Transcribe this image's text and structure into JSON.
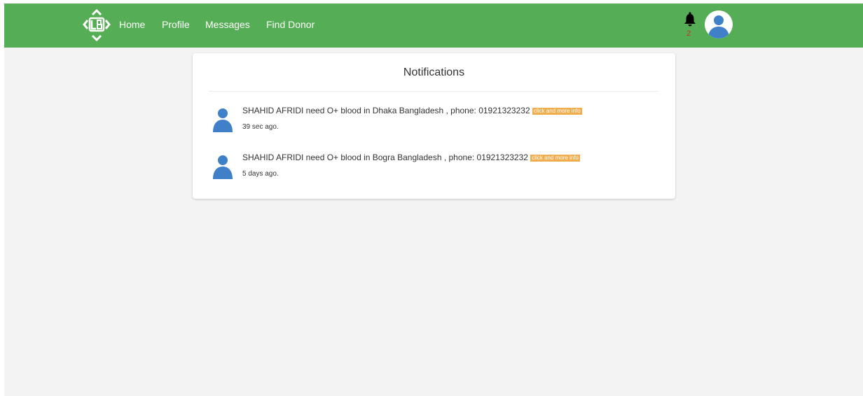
{
  "nav": {
    "logo_icon": "lb-logo-icon",
    "links": [
      {
        "label": "Home"
      },
      {
        "label": "Profile"
      },
      {
        "label": "Messages"
      },
      {
        "label": "Find Donor"
      }
    ],
    "notification_count": "2",
    "bell_icon": "bell-icon",
    "avatar_icon": "user-avatar-icon"
  },
  "notifications": {
    "title": "Notifications",
    "items": [
      {
        "message": "SHAHID AFRIDI need O+ blood in Dhaka Bangladesh , phone: 01921323232",
        "action_label": "click and more info",
        "time": "39 sec ago."
      },
      {
        "message": "SHAHID AFRIDI need O+ blood in Bogra Bangladesh , phone: 01921323232",
        "action_label": "click and more info",
        "time": "5 days ago."
      }
    ]
  },
  "colors": {
    "navbar": "#55ad55",
    "avatar_blue": "#3f80c9",
    "badge": "#f0ad4e",
    "badge_count": "#cc2a2a"
  }
}
